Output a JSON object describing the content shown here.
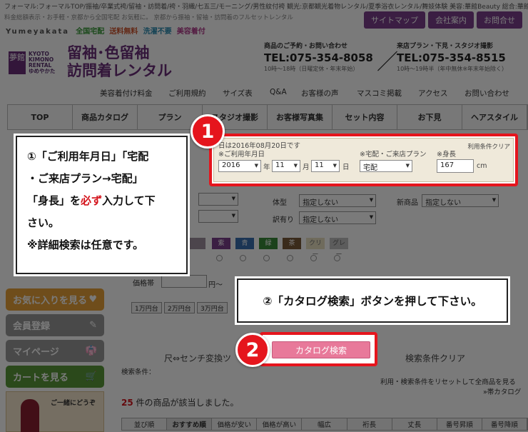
{
  "header": {
    "topline": "フォーマル:フォーマルTOP/振袖/卒業式袴/留袖・訪問着/袴・羽織/七五三/モーニング/男性紋付袴 観光:京都観光着物レンタル/夏季浴衣レンタル/舞妓体験 美容:華館Beauty 総合:華館総合",
    "subline": "料金総額表示・お手軽・京都から全国宅配 お気軽に。 京都から振袖・留袖・訪問着のフルセットレンタル",
    "brand": {
      "name": "Yumeyakata",
      "tag1": "全国宅配",
      "tag2": "送料無料",
      "tag3": "洗濯不要",
      "tag4": "美容着付"
    },
    "top_links": [
      "サイトマップ",
      "会社案内",
      "お問合せ"
    ],
    "logo_glyph": "夢館",
    "logo_text": [
      "KYOTO",
      "KIMONO",
      "RENTAL",
      "ゆめやかた"
    ],
    "title_line1": "留袖･色留袖",
    "title_line2": "訪問着レンタル",
    "contact1": {
      "label": "商品のご予約・お問い合わせ",
      "tel": "TEL:075-354-8058",
      "hours": "10時〜18時（日曜定休・年末年始）"
    },
    "slash": "／",
    "contact2": {
      "label": "来店プラン・下見・スタジオ撮影",
      "tel": "TEL:075-354-8515",
      "hours": "10時〜19時半（年中無休※年末年始除く）"
    }
  },
  "subnav": [
    "美容着付け料金",
    "ご利用規約",
    "サイズ表",
    "Q&A",
    "お客様の声",
    "マスコミ掲載",
    "アクセス",
    "お問い合わせ"
  ],
  "mainnav": [
    "TOP",
    "商品カタログ",
    "プラン",
    "スタジオ撮影",
    "お客様写真集",
    "セット内容",
    "お下見",
    "ヘアスタイル"
  ],
  "search_panel": {
    "date_note": "日は2016年08月20日です",
    "terms_link": "利用条件クリア",
    "date_label": "※ご利用年月日",
    "year": "2016",
    "year_unit": "年",
    "month": "11",
    "month_unit": "月",
    "day": "11",
    "day_unit": "日",
    "plan_label": "※宅配・ご来店プラン",
    "plan_value": "宅配",
    "height_label": "※身長",
    "height_value": "167",
    "height_unit": "cm"
  },
  "filters": {
    "body_label": "体型",
    "body_value": "指定しない",
    "new_label": "新商品",
    "new_value": "指定しない",
    "crest_label": "訳有り",
    "crest_value": "指定しない",
    "left_value1": "",
    "left_value2": ""
  },
  "colors": [
    "紫",
    "青",
    "緑",
    "茶",
    "クリー",
    "グレー"
  ],
  "price": {
    "label": "価格帯",
    "sep": "円〜",
    "chips": [
      "1万円台",
      "2万円台",
      "3万円台"
    ]
  },
  "side_buttons": [
    "お気に入りを見る",
    "会員登録",
    "マイページ",
    "カートを見る"
  ],
  "side_banner": "ご一緒にどうぞ",
  "callout1": {
    "line1": "①「ご利用年月日」「宅配",
    "line2": "・ご来店プラン→宅配」",
    "line3_pre": "「身長」を",
    "line3_hl": "必ず",
    "line3_post": "入力して下",
    "line4": "さい。",
    "line5": "※詳細検索は任意です。"
  },
  "callout2": {
    "text": "②「カタログ検索」ボタンを押して下さい。"
  },
  "marker1": "1",
  "marker2": "2",
  "catalog_button": "カタログ検索",
  "condition_clear": "検索条件クリア",
  "size_toggle": "尺⇔センチ変換ツ",
  "search_conditions": "検索条件：",
  "reset_note": "利用・検索条件をリセットして全商品を見る",
  "catalog_link": "»帯カタログ",
  "result_count": "25",
  "result_text": "件の商品が該当しました。",
  "sort": [
    "並び順",
    "おすすめ順",
    "価格が安い",
    "価格が高い",
    "幅広",
    "裄長",
    "丈長",
    "番号昇順",
    "番号降順"
  ]
}
